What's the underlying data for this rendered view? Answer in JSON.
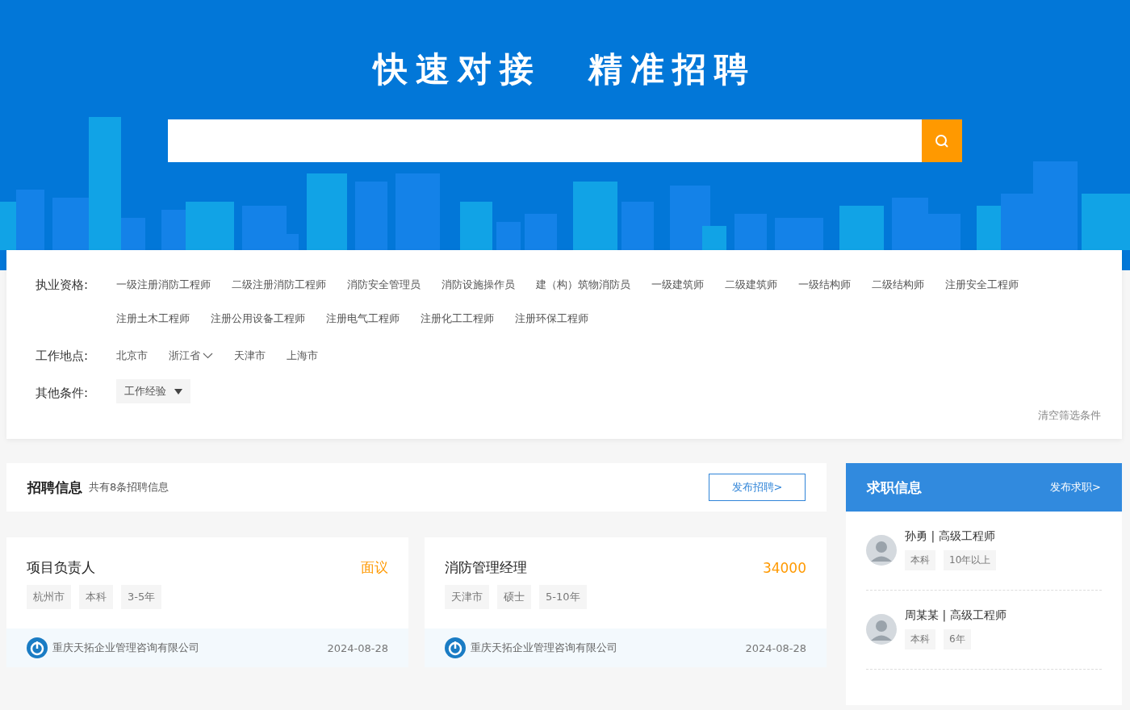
{
  "banner": {
    "title_parts": [
      "快速对接",
      "精准招聘"
    ]
  },
  "filters": [
    {
      "label": "执业资格:",
      "options": [
        {
          "text": "一级注册消防工程师",
          "kind": "plain"
        },
        {
          "text": "二级注册消防工程师",
          "kind": "plain"
        },
        {
          "text": "消防安全管理员",
          "kind": "plain"
        },
        {
          "text": "消防设施操作员",
          "kind": "plain"
        },
        {
          "text": "建（构）筑物消防员",
          "kind": "plain"
        },
        {
          "text": "一级建筑师",
          "kind": "plain"
        },
        {
          "text": "二级建筑师",
          "kind": "plain"
        },
        {
          "text": "一级结构师",
          "kind": "plain"
        },
        {
          "text": "二级结构师",
          "kind": "plain"
        },
        {
          "text": "注册安全工程师",
          "kind": "plain"
        },
        {
          "text": "注册土木工程师",
          "kind": "plain"
        },
        {
          "text": "注册公用设备工程师",
          "kind": "plain"
        },
        {
          "text": "注册电气工程师",
          "kind": "plain"
        },
        {
          "text": "注册化工工程师",
          "kind": "plain"
        },
        {
          "text": "注册环保工程师",
          "kind": "plain"
        }
      ]
    },
    {
      "label": "工作地点:",
      "options": [
        {
          "text": "北京市",
          "kind": "plain"
        },
        {
          "text": "浙江省",
          "kind": "dropdown"
        },
        {
          "text": "天津市",
          "kind": "plain"
        },
        {
          "text": "上海市",
          "kind": "plain"
        }
      ]
    },
    {
      "label": "其他条件:",
      "options": [
        {
          "text": "工作经验",
          "kind": "select"
        }
      ]
    }
  ],
  "clear_filters": "清空筛选条件",
  "jobs": {
    "title": "招聘信息",
    "count": "共有8条招聘信息",
    "post_button": "发布招聘>",
    "items": [
      {
        "title": "项目负责人",
        "salary": "面议",
        "tags": [
          "杭州市",
          "本科",
          "3-5年"
        ],
        "company": "重庆天拓企业管理咨询有限公司",
        "date": "2024-08-28"
      },
      {
        "title": "消防管理经理",
        "salary": "34000",
        "tags": [
          "天津市",
          "硕士",
          "5-10年"
        ],
        "company": "重庆天拓企业管理咨询有限公司",
        "date": "2024-08-28"
      }
    ]
  },
  "seekers": {
    "title": "求职信息",
    "post_link": "发布求职>",
    "items": [
      {
        "name": "孙勇 | 高级工程师",
        "tags": [
          "本科",
          "10年以上"
        ]
      },
      {
        "name": "周某某 | 高级工程师",
        "tags": [
          "本科",
          "6年"
        ]
      }
    ]
  }
}
